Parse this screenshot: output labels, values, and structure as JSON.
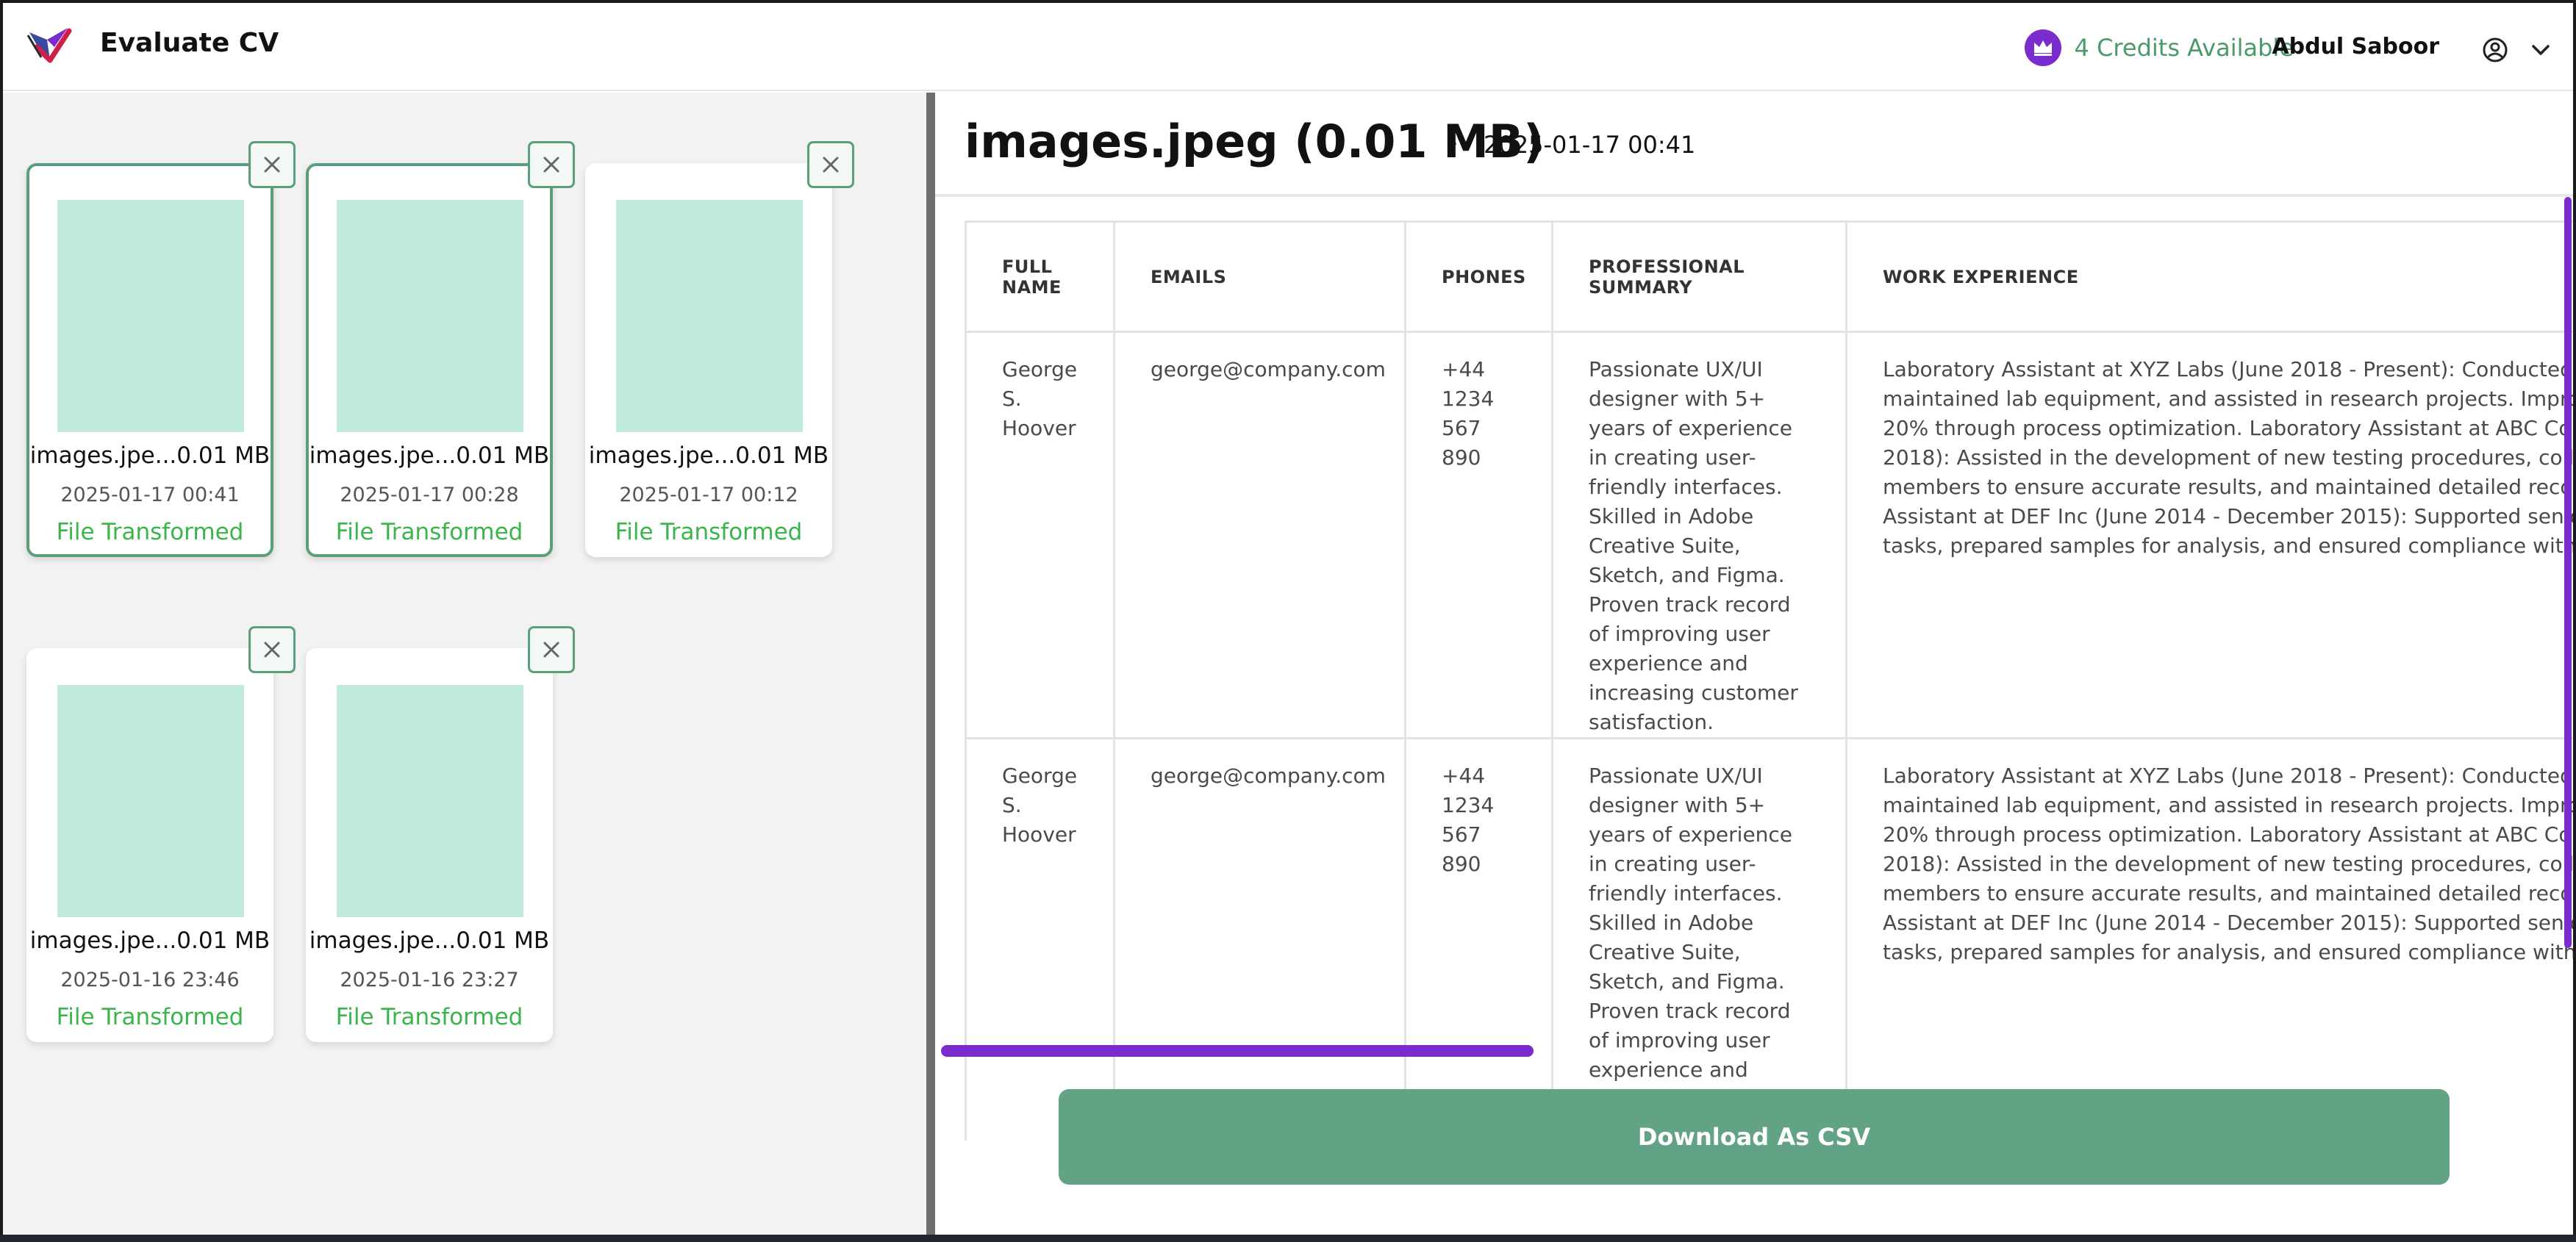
{
  "header": {
    "app_title": "Evaluate CV",
    "credits_label": "4 Credits Available",
    "user_name": "Abdul Saboor",
    "accent_color": "#7b2ccc",
    "credits_color": "#4a9a6a"
  },
  "files": [
    {
      "name": "images.jpe...0.01 MB",
      "date": "2025-01-17 00:41",
      "status": "File Transformed",
      "selected": true
    },
    {
      "name": "images.jpe...0.01 MB",
      "date": "2025-01-17 00:28",
      "status": "File Transformed",
      "selected": true
    },
    {
      "name": "images.jpe...0.01 MB",
      "date": "2025-01-17 00:12",
      "status": "File Transformed",
      "selected": false
    },
    {
      "name": "images.jpe...0.01 MB",
      "date": "2025-01-16 23:46",
      "status": "File Transformed",
      "selected": false
    },
    {
      "name": "images.jpe...0.01 MB",
      "date": "2025-01-16 23:27",
      "status": "File Transformed",
      "selected": false
    }
  ],
  "document": {
    "title": "images.jpeg (0.01 MB)",
    "separator": "-",
    "date": "2025-01-17 00:41"
  },
  "table": {
    "columns": [
      "FULL NAME",
      "EMAILS",
      "PHONES",
      "PROFESSIONAL SUMMARY",
      "WORK EXPERIENCE"
    ],
    "rows": [
      {
        "full_name": "George S. Hoover",
        "email": "george@company.com",
        "phone": "+44 1234 567 890",
        "summary": "Passionate UX/UI designer with 5+ years of experience in creating user-friendly interfaces. Skilled in Adobe Creative Suite, Sketch, and Figma. Proven track record of improving user experience and increasing customer satisfaction.",
        "work_experience": "Laboratory Assistant at XYZ Labs (June 2018 - Present): Conducted experiments, maintained lab equipment, and assisted in research projects. Improved lab efficiency by 20% through process optimization. Laboratory Assistant at ABC Corp (January 2016 - May 2018): Assisted in the development of new testing procedures, collaborated with team members to ensure accurate results, and maintained detailed records. Laboratory Assistant at DEF Inc (June 2014 - December 2015): Supported senior scientists in daily tasks, prepared samples for analysis, and ensured compliance with safety regulations."
      },
      {
        "full_name": "George S. Hoover",
        "email": "george@company.com",
        "phone": "+44 1234 567 890",
        "summary": "Passionate UX/UI designer with 5+ years of experience in creating user-friendly interfaces. Skilled in Adobe Creative Suite, Sketch, and Figma. Proven track record of improving user experience and increasing customer satisfaction.",
        "work_experience": "Laboratory Assistant at XYZ Labs (June 2018 - Present): Conducted experiments, maintained lab equipment, and assisted in research projects. Improved lab efficiency by 20% through process optimization. Laboratory Assistant at ABC Corp (January 2016 - May 2018): Assisted in the development of new testing procedures, collaborated with team members to ensure accurate results, and maintained detailed records. Laboratory Assistant at DEF Inc (June 2014 - December 2015): Supported senior scientists in daily tasks, prepared samples for analysis, and ensured compliance with safety regulations."
      }
    ]
  },
  "actions": {
    "download_label": "Download As CSV"
  },
  "icons": {
    "logo": "app-logo-icon",
    "credits": "crown-icon",
    "user": "user-circle-icon",
    "menu": "chevron-down-icon",
    "close": "close-icon"
  }
}
